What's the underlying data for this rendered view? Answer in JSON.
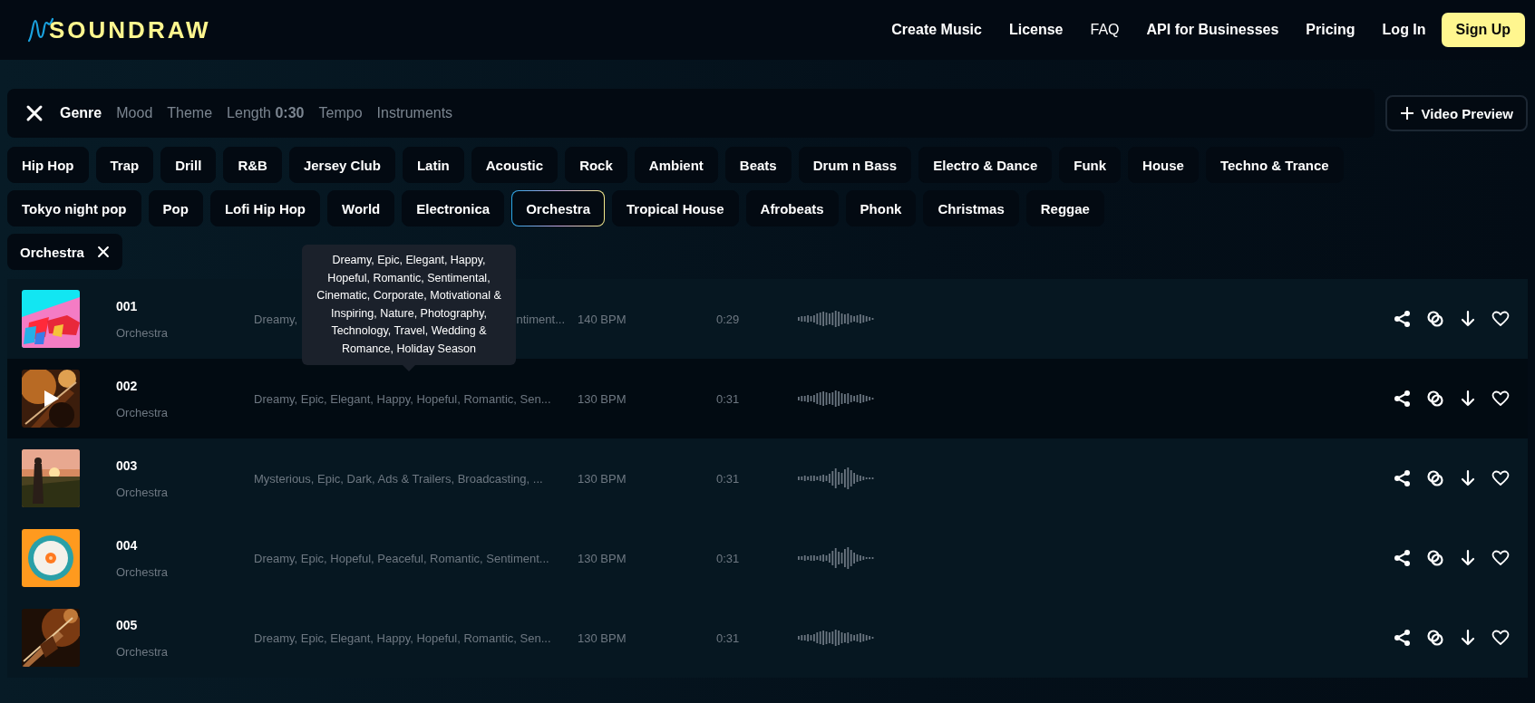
{
  "header": {
    "logo": "SOUNDRAW",
    "nav": [
      {
        "label": "Create Music",
        "strong": true
      },
      {
        "label": "License",
        "strong": true
      },
      {
        "label": "FAQ",
        "strong": false
      },
      {
        "label": "API for Businesses",
        "strong": true
      },
      {
        "label": "Pricing",
        "strong": true
      },
      {
        "label": "Log In",
        "strong": true
      }
    ],
    "cta": "Sign Up"
  },
  "filters": {
    "tabs": [
      {
        "label": "Genre",
        "selected": true
      },
      {
        "label": "Mood",
        "selected": false
      },
      {
        "label": "Theme",
        "selected": false
      },
      {
        "label": "Length",
        "value": "0:30",
        "selected": false
      },
      {
        "label": "Tempo",
        "selected": false
      },
      {
        "label": "Instruments",
        "selected": false
      }
    ],
    "video_preview": "Video Preview"
  },
  "genres": [
    {
      "label": "Hip Hop",
      "selected": false
    },
    {
      "label": "Trap",
      "selected": false
    },
    {
      "label": "Drill",
      "selected": false
    },
    {
      "label": "R&B",
      "selected": false
    },
    {
      "label": "Jersey Club",
      "selected": false
    },
    {
      "label": "Latin",
      "selected": false
    },
    {
      "label": "Acoustic",
      "selected": false
    },
    {
      "label": "Rock",
      "selected": false
    },
    {
      "label": "Ambient",
      "selected": false
    },
    {
      "label": "Beats",
      "selected": false
    },
    {
      "label": "Drum n Bass",
      "selected": false
    },
    {
      "label": "Electro & Dance",
      "selected": false
    },
    {
      "label": "Funk",
      "selected": false
    },
    {
      "label": "House",
      "selected": false
    },
    {
      "label": "Techno & Trance",
      "selected": false
    },
    {
      "label": "Tokyo night pop",
      "selected": false
    },
    {
      "label": "Pop",
      "selected": false
    },
    {
      "label": "Lofi Hip Hop",
      "selected": false
    },
    {
      "label": "World",
      "selected": false
    },
    {
      "label": "Electronica",
      "selected": false
    },
    {
      "label": "Orchestra",
      "selected": true
    },
    {
      "label": "Tropical House",
      "selected": false
    },
    {
      "label": "Afrobeats",
      "selected": false
    },
    {
      "label": "Phonk",
      "selected": false
    },
    {
      "label": "Christmas",
      "selected": false
    },
    {
      "label": "Reggae",
      "selected": false
    }
  ],
  "active_filters": [
    "Orchestra"
  ],
  "tooltip": "Dreamy, Epic, Elegant, Happy, Hopeful, Romantic, Sentimental, Cinematic, Corporate, Motivational & Inspiring, Nature, Photography, Technology, Travel, Wedding & Romance, Holiday Season",
  "tracks": [
    {
      "title": "001",
      "genre": "Orchestra",
      "tags": "Dreamy,",
      "tags_end": "ntiment...",
      "bpm": "140 BPM",
      "length": "0:29",
      "hovered": false
    },
    {
      "title": "002",
      "genre": "Orchestra",
      "tags": "Dreamy, Epic, Elegant, Happy, Hopeful, Romantic, Sen...",
      "bpm": "130 BPM",
      "length": "0:31",
      "hovered": true
    },
    {
      "title": "003",
      "genre": "Orchestra",
      "tags": "Mysterious, Epic, Dark, Ads & Trailers, Broadcasting, ...",
      "bpm": "130 BPM",
      "length": "0:31",
      "hovered": false
    },
    {
      "title": "004",
      "genre": "Orchestra",
      "tags": "Dreamy, Epic, Hopeful, Peaceful, Romantic, Sentiment...",
      "bpm": "130 BPM",
      "length": "0:31",
      "hovered": false
    },
    {
      "title": "005",
      "genre": "Orchestra",
      "tags": "Dreamy, Epic, Elegant, Happy, Hopeful, Romantic, Sen...",
      "bpm": "130 BPM",
      "length": "0:31",
      "hovered": false
    }
  ]
}
